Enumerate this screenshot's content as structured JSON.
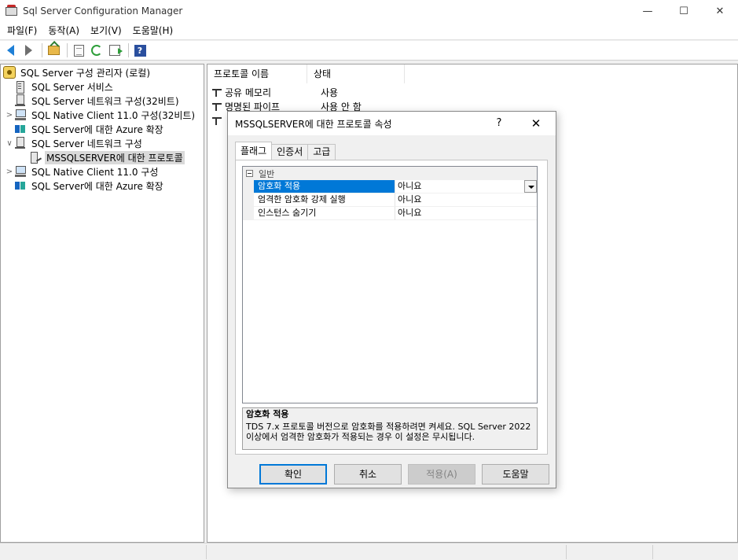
{
  "window": {
    "title": "Sql Server Configuration Manager",
    "controls": {
      "minimize": "—",
      "maximize": "☐",
      "close": "✕"
    }
  },
  "menu": [
    "파일(F)",
    "동작(A)",
    "보기(V)",
    "도움말(H)"
  ],
  "toolbar": {
    "icons": [
      "back-arrow-icon",
      "forward-arrow-icon",
      "up-folder-icon",
      "properties-icon",
      "refresh-icon",
      "export-list-icon",
      "help-icon"
    ],
    "help_glyph": "?"
  },
  "tree": {
    "items": [
      {
        "label": "SQL Server 구성 관리자 (로컬)",
        "icon": "config-manager-icon",
        "expander": ""
      },
      {
        "label": "SQL Server 서비스",
        "icon": "server-services-icon",
        "expander": ""
      },
      {
        "label": "SQL Server 네트워크 구성(32비트)",
        "icon": "network-config-icon",
        "expander": ""
      },
      {
        "label": "SQL Native Client 11.0 구성(32비트)",
        "icon": "client-config-icon",
        "expander": ">"
      },
      {
        "label": "SQL Server에 대한 Azure 확장",
        "icon": "azure-extension-icon",
        "expander": ""
      },
      {
        "label": "SQL Server 네트워크 구성",
        "icon": "network-config-icon",
        "expander": "∨"
      },
      {
        "label": "MSSQLSERVER에 대한 프로토콜",
        "icon": "protocol-icon",
        "expander": ""
      },
      {
        "label": "SQL Native Client 11.0 구성",
        "icon": "client-config-icon",
        "expander": ">"
      },
      {
        "label": "SQL Server에 대한 Azure 확장",
        "icon": "azure-extension-icon",
        "expander": ""
      }
    ],
    "selected_index": 6
  },
  "list": {
    "columns": [
      "프로토콜 이름",
      "상태"
    ],
    "rows": [
      {
        "name": "공유 메모리",
        "status": "사용"
      },
      {
        "name": "명명된 파이프",
        "status": "사용 안 함"
      }
    ]
  },
  "dialog": {
    "title": "MSSQLSERVER에 대한 프로토콜 속성",
    "help_glyph": "?",
    "close_glyph": "✕",
    "tabs": [
      "플래그",
      "인증서",
      "고급"
    ],
    "active_tab": 0,
    "category": "일반",
    "properties": [
      {
        "name": "암호화 적용",
        "value": "아니요",
        "selected": true
      },
      {
        "name": "엄격한 암호화 강제 실행",
        "value": "아니요",
        "selected": false
      },
      {
        "name": "인스턴스 숨기기",
        "value": "아니요",
        "selected": false
      }
    ],
    "description": {
      "title": "암호화 적용",
      "text": "TDS 7.x 프로토콜 버전으로 암호화를 적용하려면 켜세요. SQL Server 2022 이상에서 엄격한 암호화가 적용되는 경우 이 설정은 무시됩니다."
    },
    "buttons": {
      "ok": "확인",
      "cancel": "취소",
      "apply": "적용(A)",
      "help": "도움말"
    }
  }
}
